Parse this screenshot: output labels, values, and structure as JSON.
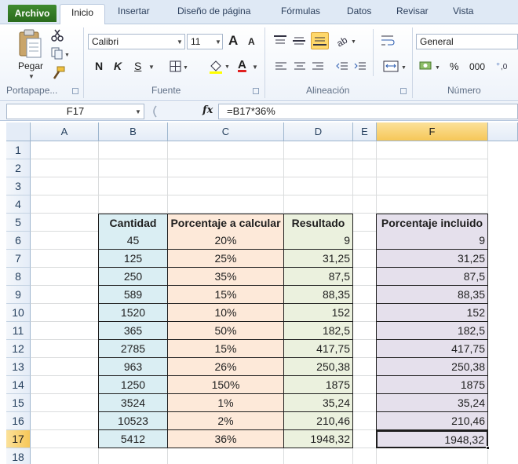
{
  "ribbon_tabs": {
    "file": "Archivo",
    "active": "Inicio",
    "others": [
      "Insertar",
      "Diseño de página",
      "Fórmulas",
      "Datos",
      "Revisar",
      "Vista"
    ]
  },
  "ribbon": {
    "clipboard": {
      "paste_label": "Pegar",
      "group_label": "Portapape..."
    },
    "font": {
      "font_name": "Calibri",
      "font_size": "11",
      "bold": "N",
      "italic": "K",
      "underline": "S",
      "grow": "A",
      "shrink": "A",
      "font_color_letter": "A",
      "group_label": "Fuente"
    },
    "alignment": {
      "group_label": "Alineación"
    },
    "number": {
      "format": "General",
      "percent": "%",
      "thousands": "000",
      "group_label": "Número"
    }
  },
  "formula_bar": {
    "name_box": "F17",
    "fx": "fx",
    "formula": "=B17*36%"
  },
  "columns": [
    "A",
    "B",
    "C",
    "D",
    "E",
    "F"
  ],
  "rows": [
    "1",
    "2",
    "3",
    "4",
    "5",
    "6",
    "7",
    "8",
    "9",
    "10",
    "11",
    "12",
    "13",
    "14",
    "15",
    "16",
    "17",
    "18"
  ],
  "selected_cell": {
    "column": "F",
    "row": "17"
  },
  "table": {
    "headers": {
      "cantidad": "Cantidad",
      "porcentaje": "Porcentaje a calcular",
      "resultado": "Resultado",
      "incluido": "Porcentaje incluido"
    },
    "rows": [
      {
        "cantidad": "45",
        "porcentaje": "20%",
        "resultado": "9",
        "incluido": "9"
      },
      {
        "cantidad": "125",
        "porcentaje": "25%",
        "resultado": "31,25",
        "incluido": "31,25"
      },
      {
        "cantidad": "250",
        "porcentaje": "35%",
        "resultado": "87,5",
        "incluido": "87,5"
      },
      {
        "cantidad": "589",
        "porcentaje": "15%",
        "resultado": "88,35",
        "incluido": "88,35"
      },
      {
        "cantidad": "1520",
        "porcentaje": "10%",
        "resultado": "152",
        "incluido": "152"
      },
      {
        "cantidad": "365",
        "porcentaje": "50%",
        "resultado": "182,5",
        "incluido": "182,5"
      },
      {
        "cantidad": "2785",
        "porcentaje": "15%",
        "resultado": "417,75",
        "incluido": "417,75"
      },
      {
        "cantidad": "963",
        "porcentaje": "26%",
        "resultado": "250,38",
        "incluido": "250,38"
      },
      {
        "cantidad": "1250",
        "porcentaje": "150%",
        "resultado": "1875",
        "incluido": "1875"
      },
      {
        "cantidad": "3524",
        "porcentaje": "1%",
        "resultado": "35,24",
        "incluido": "35,24"
      },
      {
        "cantidad": "10523",
        "porcentaje": "2%",
        "resultado": "210,46",
        "incluido": "210,46"
      },
      {
        "cantidad": "5412",
        "porcentaje": "36%",
        "resultado": "1948,32",
        "incluido": "1948,32"
      }
    ]
  },
  "colors": {
    "cantidad_fill": "#daeef3",
    "porcentaje_fill": "#fde9d9",
    "resultado_fill": "#ebf1de",
    "incluido_fill": "#e5e0ec",
    "file_tab": "#2a6b1d",
    "selection_header": "#f6c758"
  }
}
